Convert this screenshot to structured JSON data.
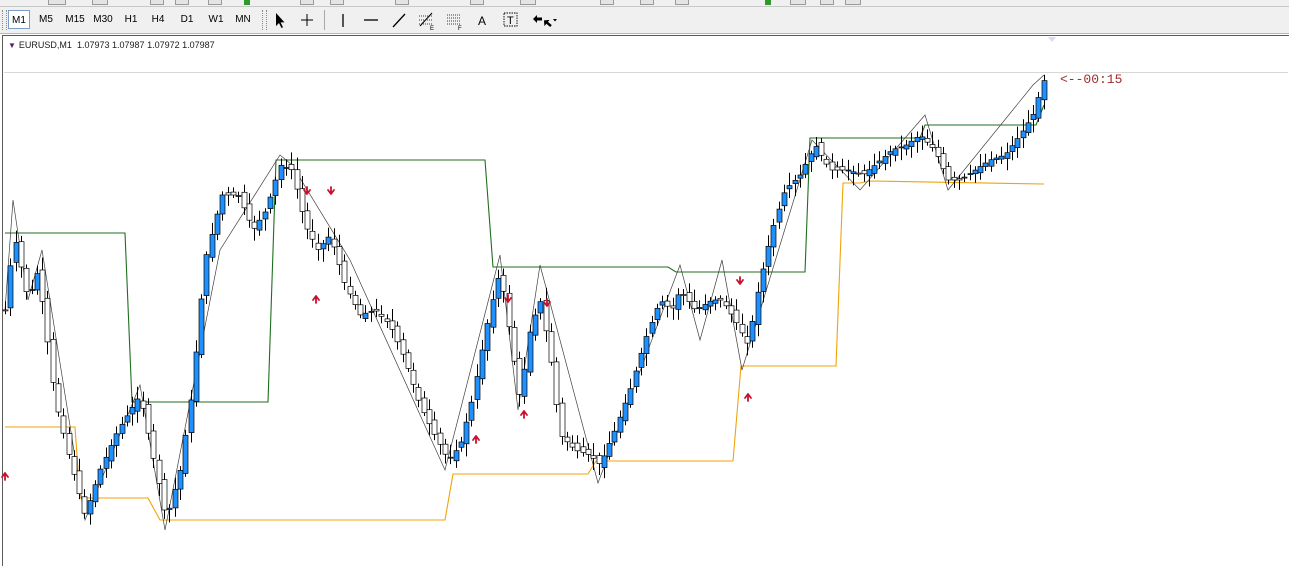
{
  "toolbar": {
    "timeframes": [
      "M1",
      "M5",
      "M15",
      "M30",
      "H1",
      "H4",
      "D1",
      "W1",
      "MN"
    ],
    "active_timeframe": "M1",
    "tools": [
      "cursor-icon",
      "crosshair-icon",
      "vertical-line-icon",
      "horizontal-line-icon",
      "trendline-icon",
      "fibonacci-icon",
      "grid-icon",
      "text-icon",
      "label-icon",
      "arrows-icon"
    ],
    "tool_letters": {
      "fibonacci": "E",
      "grid": "F",
      "text": "A",
      "label": "T"
    }
  },
  "symbol_bar": {
    "symbol": "EURUSD,M1",
    "open": "1.07973",
    "high": "1.07987",
    "low": "1.07972",
    "close": "1.07987"
  },
  "timer_label": "<--00:15",
  "colors": {
    "bull_body": "#1e90ff",
    "bear_body": "#ffffff",
    "wick": "#000000",
    "upper_channel": "#1f6e1f",
    "lower_channel": "#f0a30a",
    "zigzag": "#404040",
    "arrow": "#c8102e",
    "timer": "#a52a2a"
  }
}
